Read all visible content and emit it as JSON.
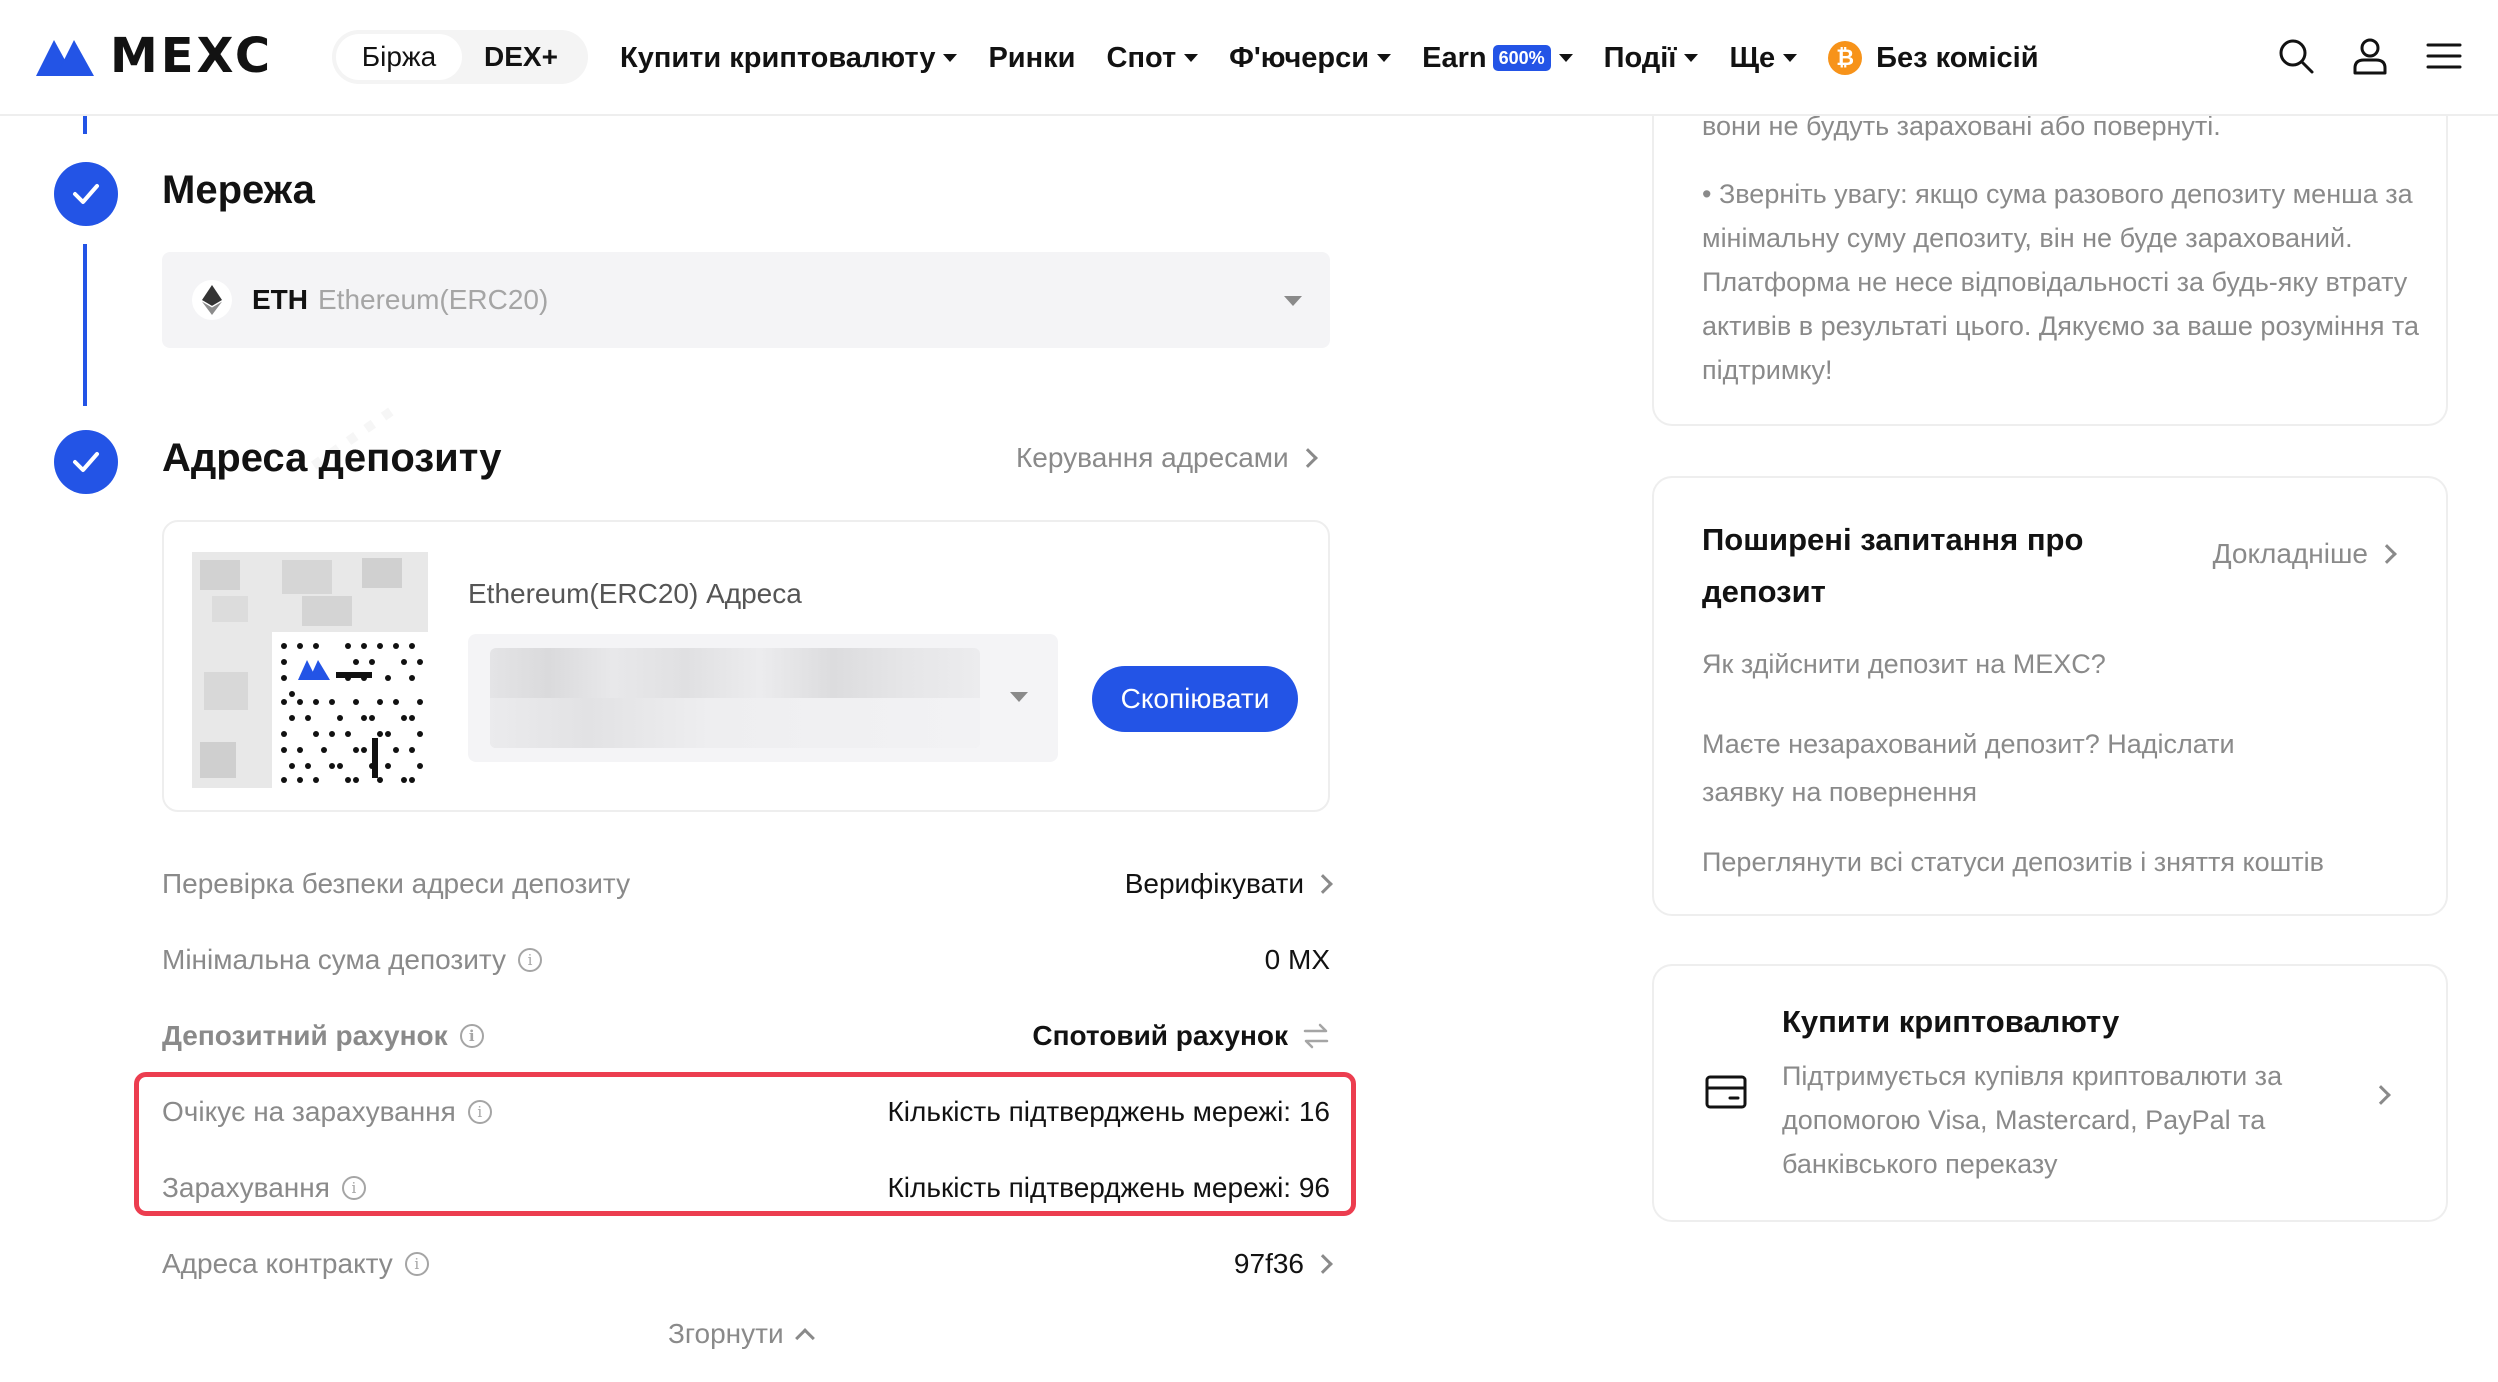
{
  "header": {
    "brand": "MEXC",
    "segments": [
      "Біржа",
      "DEX+"
    ],
    "nav": [
      {
        "label": "Купити криптовалюту",
        "dropdown": true
      },
      {
        "label": "Ринки",
        "dropdown": false
      },
      {
        "label": "Спот",
        "dropdown": true
      },
      {
        "label": "Ф'ючерси",
        "dropdown": true
      },
      {
        "label": "Earn",
        "badge": "600%",
        "dropdown": true
      },
      {
        "label": "Події",
        "dropdown": true
      },
      {
        "label": "Ще",
        "dropdown": true
      }
    ],
    "promo": {
      "coin": "₿",
      "label": "Без комісій"
    },
    "icons": [
      "search-icon",
      "user-icon",
      "menu-icon"
    ]
  },
  "network": {
    "title": "Мережа",
    "selected_code": "ETH",
    "selected_name": "Ethereum(ERC20)"
  },
  "deposit_address": {
    "title": "Адреса депозиту",
    "manage_link": "Керування адресами",
    "address_label": "Ethereum(ERC20) Адреса",
    "copy_button": "Скопіювати"
  },
  "info_rows": [
    {
      "label": "Перевірка безпеки адреси депозиту",
      "value": "Верифікувати",
      "has_info": false,
      "has_chevron": true
    },
    {
      "label": "Мінімальна сума депозиту",
      "value": "0 MX",
      "has_info": true,
      "has_chevron": false
    },
    {
      "label": "Депозитний рахунок",
      "value": "Спотовий рахунок",
      "has_info": true,
      "has_chevron": false
    },
    {
      "label": "Очікує на зарахування",
      "value": "Кількість підтверджень мережі: 16",
      "has_info": true,
      "has_chevron": false
    },
    {
      "label": "Зарахування",
      "value": "Кількість підтверджень мережі: 96",
      "has_info": true,
      "has_chevron": false
    },
    {
      "label": "Адреса контракту",
      "value": "97f36",
      "has_info": true,
      "has_chevron": true
    }
  ],
  "collapse_label": "Згорнути",
  "notice": {
    "cut_line": "вони не будуть зараховані або повернуті.",
    "text": "• Зверніть увагу: якщо сума разового депозиту менша за мінімальну суму депозиту, він не буде зарахований. Платформа не несе відповідальності за будь-яку втрату активів в результаті цього. Дякуємо за ваше розуміння та підтримку!"
  },
  "faq": {
    "title": "Поширені запитання про депозит",
    "more": "Докладніше",
    "items": [
      "Як здійснити депозит на MEXC?",
      "Маєте незарахований депозит? Надіслати заявку на повернення",
      "Переглянути всі статуси депозитів і зняття коштів"
    ]
  },
  "buy_crypto": {
    "title": "Купити криптовалюту",
    "desc": "Підтримується купівля криптовалюти за допомогою Visa, Mastercard, PayPal та банківського переказу"
  },
  "colors": {
    "accent": "#2354e6",
    "highlight": "#ec3d4f",
    "muted": "#8a8a8a"
  }
}
